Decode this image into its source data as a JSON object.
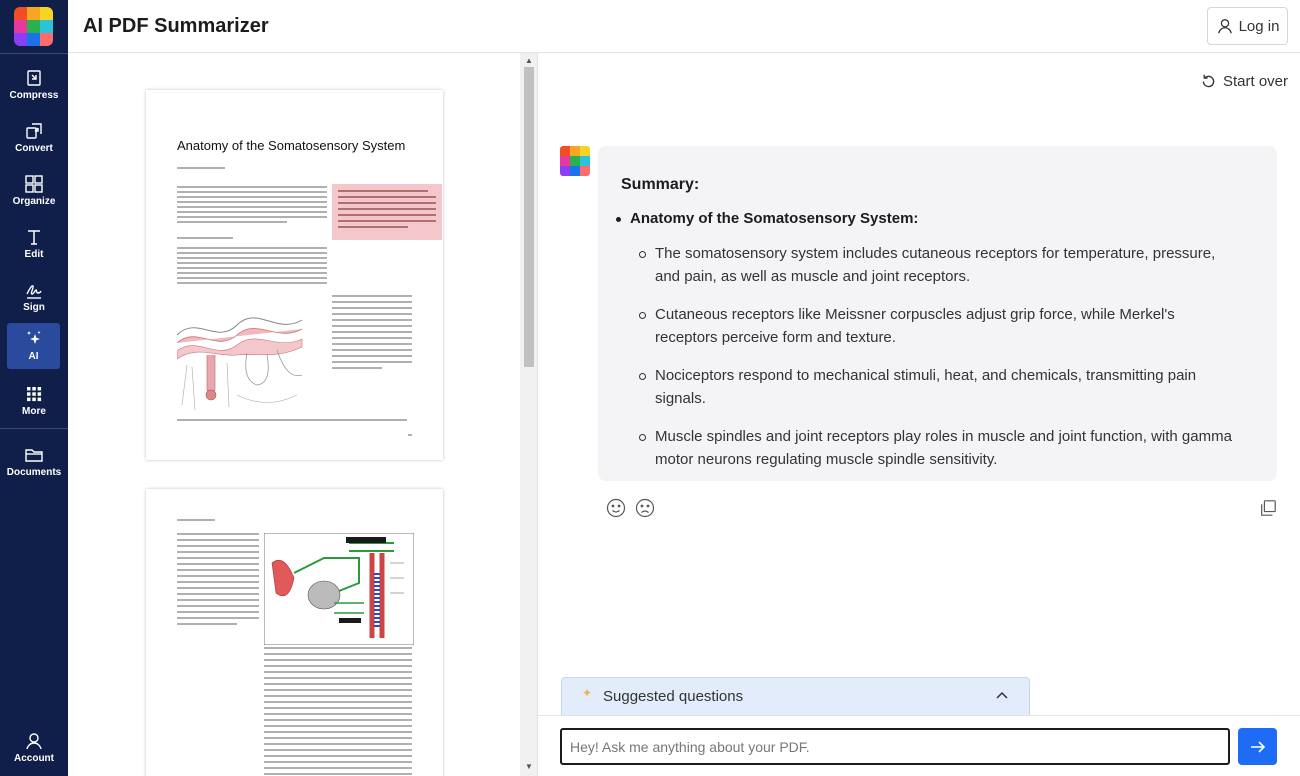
{
  "app": {
    "title": "AI PDF Summarizer",
    "login_label": "Log in"
  },
  "brand_colors": [
    "#f04e23",
    "#f6a623",
    "#f5d423",
    "#28b14c",
    "#1a73e8",
    "#2cc2d9",
    "#8b3ff5",
    "#e6399b",
    "#ff6b6b"
  ],
  "sidebar": {
    "items": [
      {
        "label": "Compress",
        "icon": "compress-icon"
      },
      {
        "label": "Convert",
        "icon": "convert-icon"
      },
      {
        "label": "Organize",
        "icon": "organize-icon"
      },
      {
        "label": "Edit",
        "icon": "edit-icon"
      },
      {
        "label": "Sign",
        "icon": "sign-icon"
      },
      {
        "label": "AI",
        "icon": "ai-sparkle-icon",
        "active": true
      },
      {
        "label": "More",
        "icon": "more-grid-icon"
      },
      {
        "label": "Documents",
        "icon": "folder-icon"
      },
      {
        "label": "Account",
        "icon": "account-icon"
      }
    ]
  },
  "pdf": {
    "page1_title": "Anatomy of the Somatosensory System"
  },
  "chat": {
    "start_over_label": "Start over",
    "summary_title": "Summary:",
    "summary_heading": "Anatomy of the Somatosensory System:",
    "points": [
      "The somatosensory system includes cutaneous receptors for temperature, pressure, and pain, as well as muscle and joint receptors.",
      "Cutaneous receptors like Meissner corpuscles adjust grip force, while Merkel's receptors perceive form and texture.",
      "Nociceptors respond to mechanical stimuli, heat, and chemicals, transmitting pain signals.",
      "Muscle spindles and joint receptors play roles in muscle and joint function, with gamma motor neurons regulating muscle spindle sensitivity."
    ],
    "suggested_label": "Suggested questions",
    "input_placeholder": "Hey! Ask me anything about your PDF."
  }
}
